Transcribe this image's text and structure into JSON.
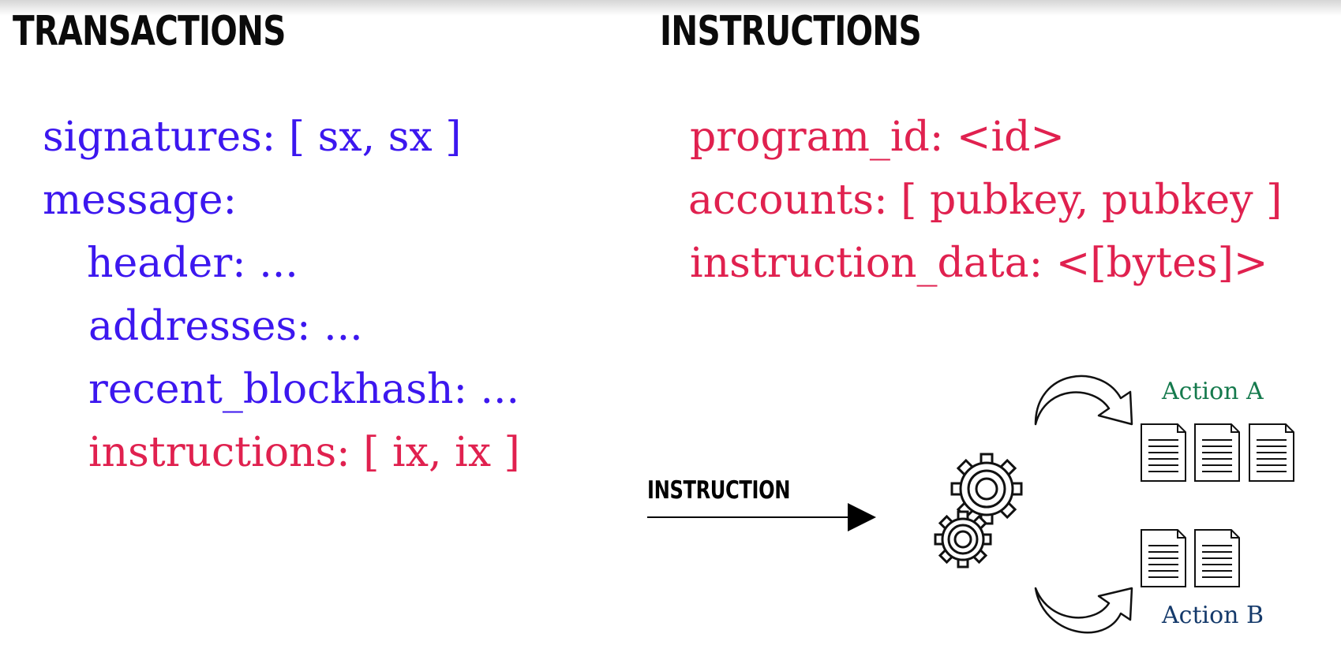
{
  "left": {
    "heading": "TRANSACTIONS",
    "lines": {
      "signatures": "signatures: [ sx, sx ]",
      "message": "message:",
      "header": "header: ...",
      "addresses": "addresses: ...",
      "recent_blockhash": "recent_blockhash: ...",
      "instructions": "instructions: [ ix, ix ]"
    }
  },
  "right": {
    "heading": "INSTRUCTIONS",
    "lines": {
      "program_id": "program_id: <id>",
      "accounts": "accounts: [ pubkey, pubkey ]",
      "instruction_data": "instruction_data: <[bytes]>"
    }
  },
  "diagram": {
    "input_label": "INSTRUCTION",
    "action_a_label": "Action A",
    "action_b_label": "Action B",
    "action_a_documents": 3,
    "action_b_documents": 2,
    "icons": [
      "arrow-right-icon",
      "gears-icon",
      "curved-arrow-icon",
      "document-icon"
    ],
    "colors": {
      "transaction_fields": "#3c17ef",
      "instruction_fields": "#e0214f",
      "action_a": "#157a4d",
      "action_b": "#153a6b"
    }
  }
}
